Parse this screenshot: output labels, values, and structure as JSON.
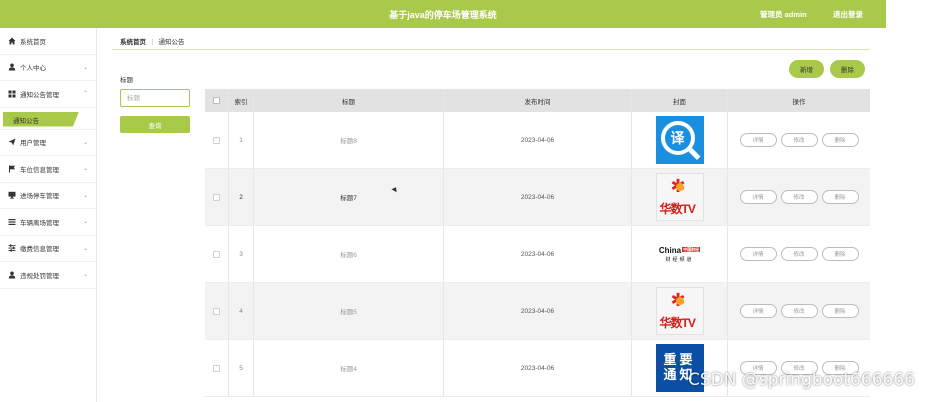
{
  "header": {
    "title": "基于java的停车场管理系统",
    "admin_label": "管理员 admin",
    "logout_label": "退出登录"
  },
  "sidebar": {
    "items": [
      {
        "label": "系统首页",
        "icon": "home-icon"
      },
      {
        "label": "个人中心",
        "icon": "user-icon"
      },
      {
        "label": "通知公告管理",
        "icon": "grid-icon"
      },
      {
        "label": "通知公告",
        "icon": ""
      },
      {
        "label": "用户管理",
        "icon": "send-icon"
      },
      {
        "label": "车位信息管理",
        "icon": "flag-icon"
      },
      {
        "label": "进场停车管理",
        "icon": "monitor-icon"
      },
      {
        "label": "车辆离场管理",
        "icon": "list-icon"
      },
      {
        "label": "缴费信息管理",
        "icon": "sliders-icon"
      },
      {
        "label": "违规处罚管理",
        "icon": "user-icon"
      }
    ]
  },
  "breadcrumb": {
    "home": "系统首页",
    "separator": "⋮",
    "current": "通知公告"
  },
  "filter": {
    "label": "标题",
    "placeholder": "标题",
    "query_label": "查询"
  },
  "toolbar": {
    "add_label": "新增",
    "delete_label": "删除"
  },
  "table": {
    "headers": {
      "index": "索引",
      "title": "标题",
      "date": "发布时间",
      "cover": "封面",
      "ops": "操作"
    },
    "rows": [
      {
        "index": "1",
        "title": "标题8",
        "date": "2023-04-06",
        "cover": "translate-logo",
        "cover_text": "译"
      },
      {
        "index": "2",
        "title": "标题7",
        "date": "2023-04-06",
        "cover": "huashu-tv-logo",
        "cover_text": "华数TV"
      },
      {
        "index": "3",
        "title": "标题6",
        "date": "2023-04-06",
        "cover": "china-finance-logo",
        "cover_text": "China",
        "cover_badge": "中国财经",
        "cover_sub": "财经频道"
      },
      {
        "index": "4",
        "title": "标题5",
        "date": "2023-04-06",
        "cover": "huashu-tv-logo",
        "cover_text": "华数TV"
      },
      {
        "index": "5",
        "title": "标题4",
        "date": "2023-04-06",
        "cover": "notice-logo",
        "cover_text": "重要",
        "cover_text2": "通知"
      }
    ],
    "row_buttons": {
      "detail": "详情",
      "edit": "修改",
      "delete": "删除"
    }
  },
  "watermark": "CSDN @springboot666666",
  "colors": {
    "accent": "#a9c94a",
    "header_bg": "#e2e2e2"
  }
}
